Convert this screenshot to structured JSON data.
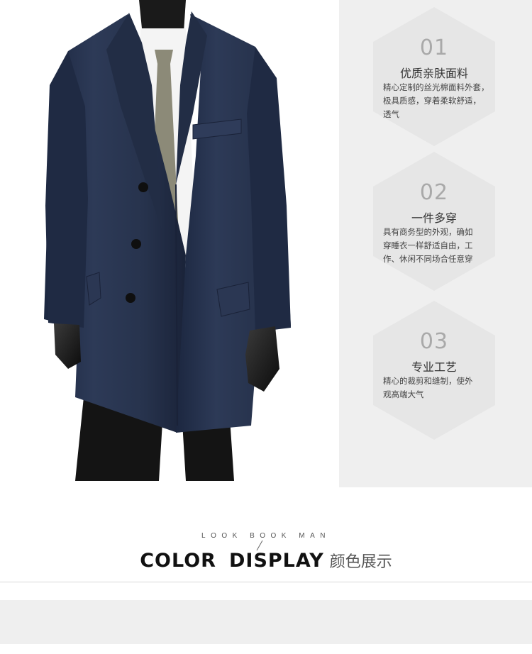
{
  "features": [
    {
      "num": "01",
      "title": "优质亲肤面料",
      "lines": [
        "精心定制的丝光棉面料外套，",
        "极具质感，穿着柔软舒适，",
        "透气"
      ]
    },
    {
      "num": "02",
      "title": "一件多穿",
      "lines": [
        "具有商务型的外观，确如",
        "穿睡衣一样舒适自由，工",
        "作、休闲不同场合任意穿"
      ]
    },
    {
      "num": "03",
      "title": "专业工艺",
      "lines": [
        "精心的裁剪和缝制，使外",
        "观高端大气"
      ]
    }
  ],
  "section": {
    "lookbook": "LOOK BOOK MAN",
    "title_word1": "COLOR",
    "title_word2": "DISPLAY",
    "title_cn": "颜色展示"
  },
  "colors": {
    "coat": "#2a3650",
    "panel": "#efefef",
    "hexagon": "#e6e6e6",
    "number": "#a9a9a9"
  }
}
